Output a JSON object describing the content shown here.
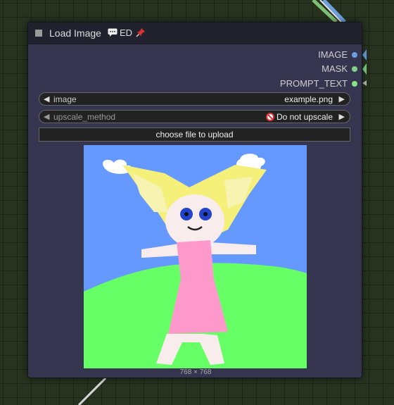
{
  "colors": {
    "canvas_bg": "#27331f",
    "node_bg": "#353550",
    "title_bg": "#22222f",
    "image_socket": "#6b9fe0",
    "mask_socket": "#7ed08a",
    "prompt_socket": "#8ae08a"
  },
  "node": {
    "title": "Load Image",
    "badge_icon": "speech-bubble-icon",
    "badge_text": "ED",
    "pin_icon": "pin-icon"
  },
  "outputs": [
    {
      "label": "IMAGE"
    },
    {
      "label": "MASK"
    },
    {
      "label": "PROMPT_TEXT"
    }
  ],
  "widgets": {
    "image": {
      "label": "image",
      "value": "example.png"
    },
    "upscale": {
      "label": "upscale_method",
      "value": "Do not upscale",
      "icon": "prohibited-icon"
    }
  },
  "upload_label": "choose file to upload",
  "image_dims": "768 × 768"
}
